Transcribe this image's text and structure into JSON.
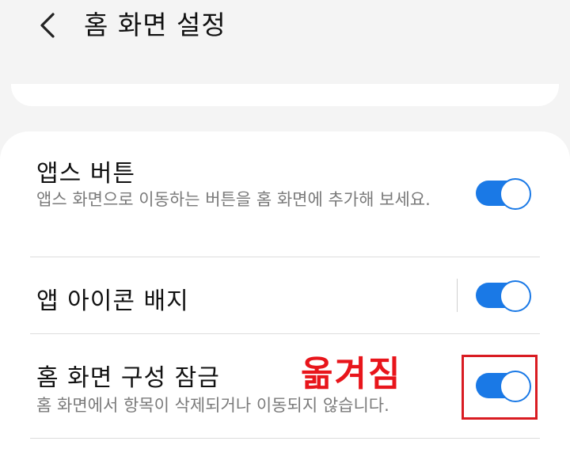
{
  "header": {
    "title": "홈 화면 설정"
  },
  "settings": [
    {
      "title": "앱스 버튼",
      "description": "앱스 화면으로 이동하는 버튼을 홈 화면에 추가해 보세요.",
      "enabled": true
    },
    {
      "title": "앱 아이콘 배지",
      "enabled": true
    },
    {
      "title": "홈 화면 구성 잠금",
      "description": "홈 화면에서 항목이 삭제되거나 이동되지 않습니다.",
      "enabled": true
    }
  ],
  "annotation": {
    "text": "옮겨짐"
  },
  "colors": {
    "accent": "#1a79e6",
    "annotation": "#e8151b",
    "background": "#f4f4f4",
    "card": "#ffffff"
  },
  "icons": {
    "back": "chevron-left-icon"
  }
}
